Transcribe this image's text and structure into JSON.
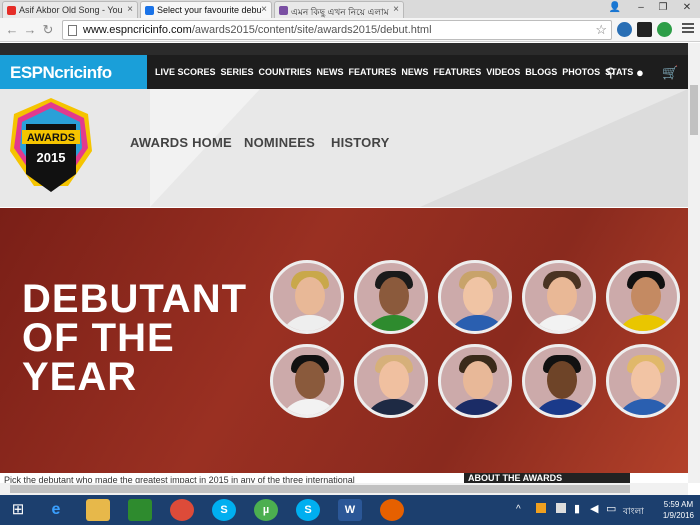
{
  "browser": {
    "tabs": [
      {
        "title": "Asif Akbor Old Song - You",
        "color": "#e52d27"
      },
      {
        "title": "Select your favourite debu",
        "color": "#1a73e8"
      },
      {
        "title": "এমন কিছু এখন নিয়ে এলাম",
        "color": "#7a4fa3"
      }
    ],
    "url_domain": "www.espncricinfo.com",
    "url_path": "/awards2015/content/site/awards2015/debut.html"
  },
  "site": {
    "logo": "ESPNcricinfo",
    "nav": [
      "LIVE SCORES",
      "SERIES",
      "COUNTRIES",
      "NEWS",
      "FEATURES",
      "NEWS",
      "FEATURES",
      "VIDEOS",
      "BLOGS",
      "PHOTOS",
      "STATS"
    ],
    "awards_logo_text": "AWARDS",
    "awards_logo_year": "2015",
    "submenu": [
      "AWARDS HOME",
      "NOMINEES",
      "HISTORY"
    ],
    "hero_title_1": "DEBUTANT",
    "hero_title_2": "OF THE",
    "hero_title_3": "YEAR",
    "bottom_text": "Pick the debutant who made the greatest impact in 2015 in any of the three international",
    "bottom_right": "ABOUT THE AWARDS"
  },
  "taskbar": {
    "time": "5:59 AM",
    "date": "1/9/2016",
    "lang": "বাংলা"
  }
}
